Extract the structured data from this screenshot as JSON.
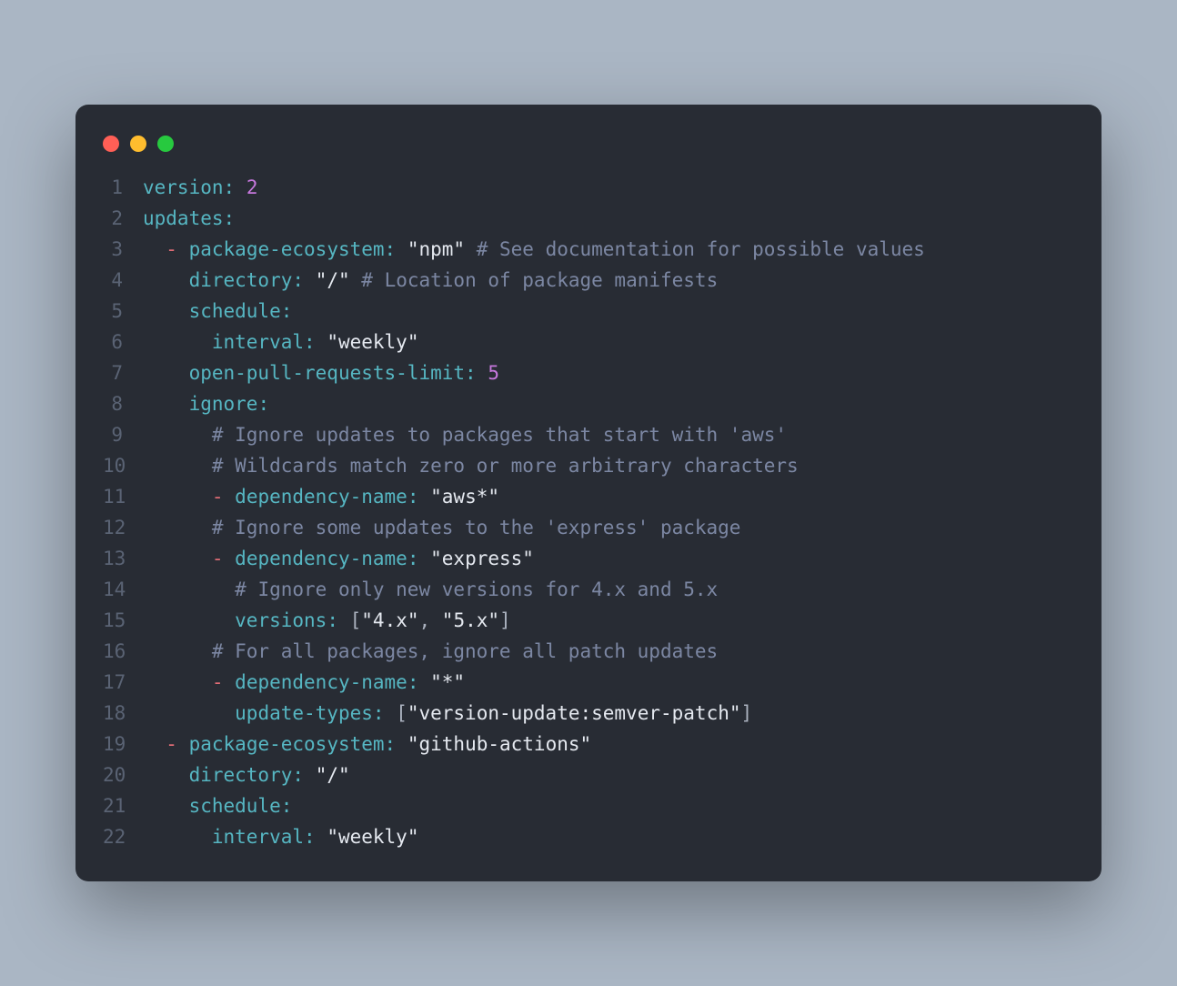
{
  "colors": {
    "page_bg": "#aab6c4",
    "window_bg": "#282c34",
    "gutter": "#5a6374",
    "key": "#56b6c2",
    "dash": "#e06c75",
    "string": "#e5e9f0",
    "number": "#c678dd",
    "comment": "#7c87a3",
    "dot_red": "#ff5f56",
    "dot_yellow": "#ffbd2e",
    "dot_green": "#27c93f"
  },
  "code": {
    "lines": [
      {
        "n": 1,
        "tokens": [
          {
            "t": "version",
            "c": "key"
          },
          {
            "t": ":",
            "c": "punct"
          },
          {
            "t": " "
          },
          {
            "t": "2",
            "c": "num"
          }
        ]
      },
      {
        "n": 2,
        "tokens": [
          {
            "t": "updates",
            "c": "key"
          },
          {
            "t": ":",
            "c": "punct"
          }
        ]
      },
      {
        "n": 3,
        "tokens": [
          {
            "t": "  "
          },
          {
            "t": "-",
            "c": "dash"
          },
          {
            "t": " "
          },
          {
            "t": "package-ecosystem",
            "c": "key"
          },
          {
            "t": ":",
            "c": "punct"
          },
          {
            "t": " "
          },
          {
            "t": "\"npm\"",
            "c": "str"
          },
          {
            "t": " "
          },
          {
            "t": "# See documentation for possible values",
            "c": "comment"
          }
        ]
      },
      {
        "n": 4,
        "tokens": [
          {
            "t": "    "
          },
          {
            "t": "directory",
            "c": "key"
          },
          {
            "t": ":",
            "c": "punct"
          },
          {
            "t": " "
          },
          {
            "t": "\"/\"",
            "c": "str"
          },
          {
            "t": " "
          },
          {
            "t": "# Location of package manifests",
            "c": "comment"
          }
        ]
      },
      {
        "n": 5,
        "tokens": [
          {
            "t": "    "
          },
          {
            "t": "schedule",
            "c": "key"
          },
          {
            "t": ":",
            "c": "punct"
          }
        ]
      },
      {
        "n": 6,
        "tokens": [
          {
            "t": "      "
          },
          {
            "t": "interval",
            "c": "key"
          },
          {
            "t": ":",
            "c": "punct"
          },
          {
            "t": " "
          },
          {
            "t": "\"weekly\"",
            "c": "str"
          }
        ]
      },
      {
        "n": 7,
        "tokens": [
          {
            "t": "    "
          },
          {
            "t": "open-pull-requests-limit",
            "c": "key"
          },
          {
            "t": ":",
            "c": "punct"
          },
          {
            "t": " "
          },
          {
            "t": "5",
            "c": "num"
          }
        ]
      },
      {
        "n": 8,
        "tokens": [
          {
            "t": "    "
          },
          {
            "t": "ignore",
            "c": "key"
          },
          {
            "t": ":",
            "c": "punct"
          }
        ]
      },
      {
        "n": 9,
        "tokens": [
          {
            "t": "      "
          },
          {
            "t": "# Ignore updates to packages that start with 'aws'",
            "c": "comment"
          }
        ]
      },
      {
        "n": 10,
        "tokens": [
          {
            "t": "      "
          },
          {
            "t": "# Wildcards match zero or more arbitrary characters",
            "c": "comment"
          }
        ]
      },
      {
        "n": 11,
        "tokens": [
          {
            "t": "      "
          },
          {
            "t": "-",
            "c": "dash"
          },
          {
            "t": " "
          },
          {
            "t": "dependency-name",
            "c": "key"
          },
          {
            "t": ":",
            "c": "punct"
          },
          {
            "t": " "
          },
          {
            "t": "\"aws*\"",
            "c": "str"
          }
        ]
      },
      {
        "n": 12,
        "tokens": [
          {
            "t": "      "
          },
          {
            "t": "# Ignore some updates to the 'express' package",
            "c": "comment"
          }
        ]
      },
      {
        "n": 13,
        "tokens": [
          {
            "t": "      "
          },
          {
            "t": "-",
            "c": "dash"
          },
          {
            "t": " "
          },
          {
            "t": "dependency-name",
            "c": "key"
          },
          {
            "t": ":",
            "c": "punct"
          },
          {
            "t": " "
          },
          {
            "t": "\"express\"",
            "c": "str"
          }
        ]
      },
      {
        "n": 14,
        "tokens": [
          {
            "t": "        "
          },
          {
            "t": "# Ignore only new versions for 4.x and 5.x",
            "c": "comment"
          }
        ]
      },
      {
        "n": 15,
        "tokens": [
          {
            "t": "        "
          },
          {
            "t": "versions",
            "c": "key"
          },
          {
            "t": ":",
            "c": "punct"
          },
          {
            "t": " "
          },
          {
            "t": "[",
            "c": "sep"
          },
          {
            "t": "\"4.x\"",
            "c": "str"
          },
          {
            "t": ", ",
            "c": "sep"
          },
          {
            "t": "\"5.x\"",
            "c": "str"
          },
          {
            "t": "]",
            "c": "sep"
          }
        ]
      },
      {
        "n": 16,
        "tokens": [
          {
            "t": "      "
          },
          {
            "t": "# For all packages, ignore all patch updates",
            "c": "comment"
          }
        ]
      },
      {
        "n": 17,
        "tokens": [
          {
            "t": "      "
          },
          {
            "t": "-",
            "c": "dash"
          },
          {
            "t": " "
          },
          {
            "t": "dependency-name",
            "c": "key"
          },
          {
            "t": ":",
            "c": "punct"
          },
          {
            "t": " "
          },
          {
            "t": "\"*\"",
            "c": "str"
          }
        ]
      },
      {
        "n": 18,
        "tokens": [
          {
            "t": "        "
          },
          {
            "t": "update-types",
            "c": "key"
          },
          {
            "t": ":",
            "c": "punct"
          },
          {
            "t": " "
          },
          {
            "t": "[",
            "c": "sep"
          },
          {
            "t": "\"version-update:semver-patch\"",
            "c": "str"
          },
          {
            "t": "]",
            "c": "sep"
          }
        ]
      },
      {
        "n": 19,
        "tokens": [
          {
            "t": "  "
          },
          {
            "t": "-",
            "c": "dash"
          },
          {
            "t": " "
          },
          {
            "t": "package-ecosystem",
            "c": "key"
          },
          {
            "t": ":",
            "c": "punct"
          },
          {
            "t": " "
          },
          {
            "t": "\"github-actions\"",
            "c": "str"
          }
        ]
      },
      {
        "n": 20,
        "tokens": [
          {
            "t": "    "
          },
          {
            "t": "directory",
            "c": "key"
          },
          {
            "t": ":",
            "c": "punct"
          },
          {
            "t": " "
          },
          {
            "t": "\"/\"",
            "c": "str"
          }
        ]
      },
      {
        "n": 21,
        "tokens": [
          {
            "t": "    "
          },
          {
            "t": "schedule",
            "c": "key"
          },
          {
            "t": ":",
            "c": "punct"
          }
        ]
      },
      {
        "n": 22,
        "tokens": [
          {
            "t": "      "
          },
          {
            "t": "interval",
            "c": "key"
          },
          {
            "t": ":",
            "c": "punct"
          },
          {
            "t": " "
          },
          {
            "t": "\"weekly\"",
            "c": "str"
          }
        ]
      }
    ]
  }
}
